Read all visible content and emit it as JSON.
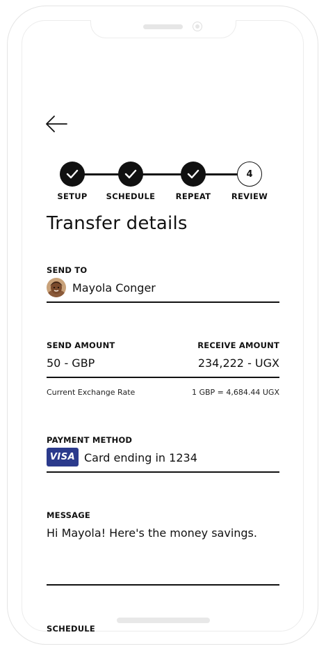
{
  "stepper": {
    "steps": [
      {
        "label": "SETUP",
        "state": "done"
      },
      {
        "label": "SCHEDULE",
        "state": "done"
      },
      {
        "label": "REPEAT",
        "state": "done"
      },
      {
        "label": "REVIEW",
        "state": "current",
        "number": "4"
      }
    ]
  },
  "page": {
    "title": "Transfer details"
  },
  "send_to": {
    "label": "SEND TO",
    "recipient": "Mayola Conger"
  },
  "amounts": {
    "send_label": "SEND AMOUNT",
    "receive_label": "RECEIVE AMOUNT",
    "send_value": "50 - GBP",
    "receive_value": "234,222 - UGX",
    "rate_label": "Current Exchange Rate",
    "rate_value": "1 GBP = 4,684.44 UGX"
  },
  "payment": {
    "label": "PAYMENT METHOD",
    "card_brand": "VISA",
    "card_text": "Card ending in 1234"
  },
  "message": {
    "label": "MESSAGE",
    "text": "Hi Mayola! Here's the money savings."
  },
  "schedule": {
    "label": "SCHEDULE"
  },
  "icons": {
    "back": "arrow-left-icon",
    "check": "checkmark-icon"
  }
}
